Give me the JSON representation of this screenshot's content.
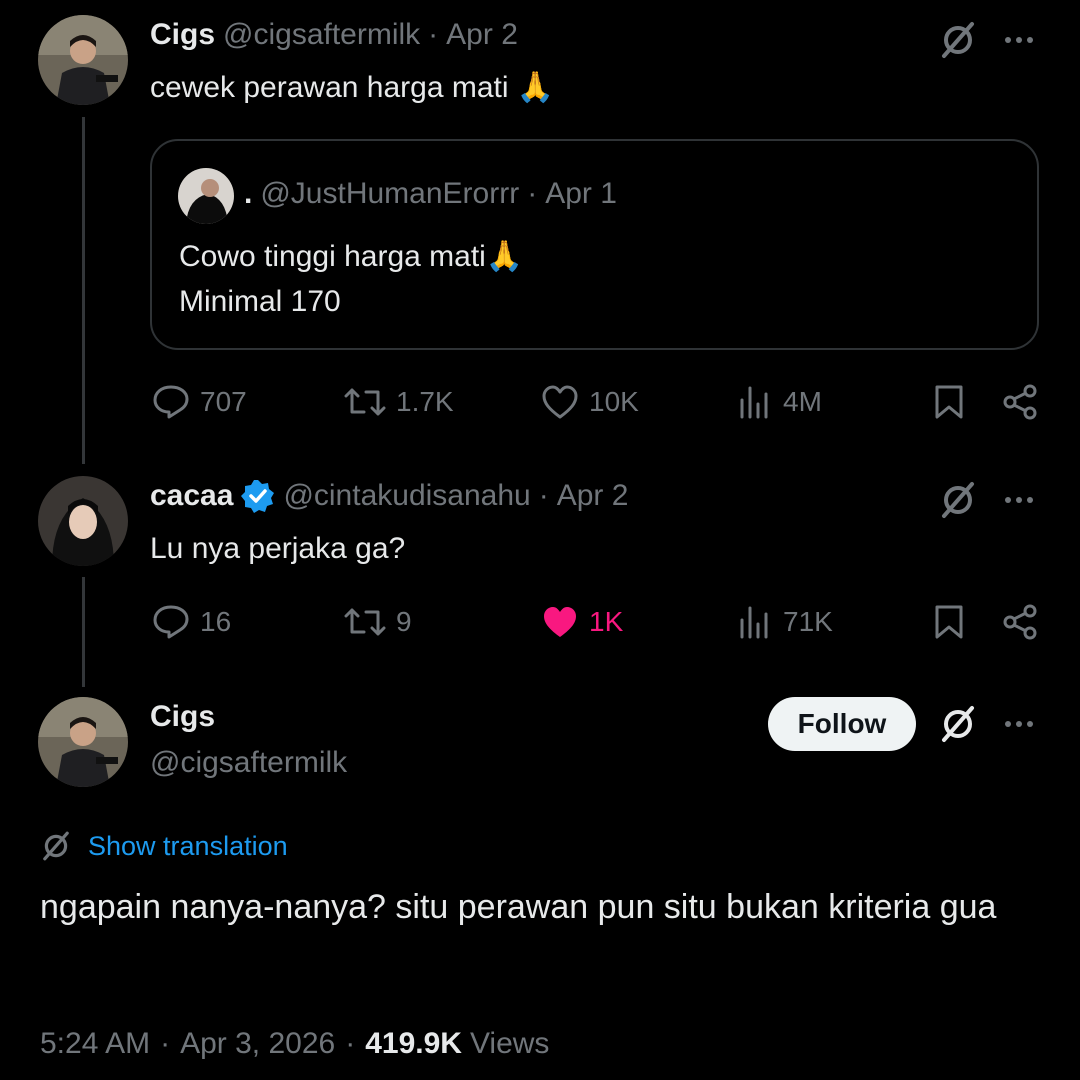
{
  "tweet1": {
    "name": "Cigs",
    "handle": "@cigsaftermilk",
    "sep": "·",
    "date": "Apr 2",
    "text": "cewek perawan harga mati 🙏",
    "quote": {
      "name": ".",
      "handle": "@JustHumanErorrr",
      "sep": "·",
      "date": "Apr 1",
      "line1": "Cowo tinggi harga mati🙏",
      "line2": "Minimal 170"
    },
    "replies": "707",
    "reposts": "1.7K",
    "likes": "10K",
    "views": "4M"
  },
  "tweet2": {
    "name": "cacaa",
    "handle": "@cintakudisanahu",
    "sep": "·",
    "date": "Apr 2",
    "text": "Lu nya perjaka ga?",
    "replies": "16",
    "reposts": "9",
    "likes": "1K",
    "views": "71K",
    "like_color": "#f91880"
  },
  "main": {
    "name": "Cigs",
    "handle": "@cigsaftermilk",
    "follow_label": "Follow",
    "translation_label": "Show translation",
    "text": "ngapain nanya-nanya? situ perawan pun situ bukan kriteria gua",
    "time": "5:24 AM",
    "sep1": "·",
    "date": "Apr 3, 2026",
    "sep2": "·",
    "views_count": "419.9K",
    "views_label": "Views"
  },
  "colors": {
    "muted": "#71767b",
    "link": "#1d9bf0",
    "verified": "#1d9bf0",
    "like_active": "#f91880"
  },
  "icons": [
    "grok-icon",
    "more-icon",
    "reply-icon",
    "repost-icon",
    "like-icon",
    "views-icon",
    "bookmark-icon",
    "share-icon",
    "verified-badge-icon",
    "translate-icon"
  ]
}
